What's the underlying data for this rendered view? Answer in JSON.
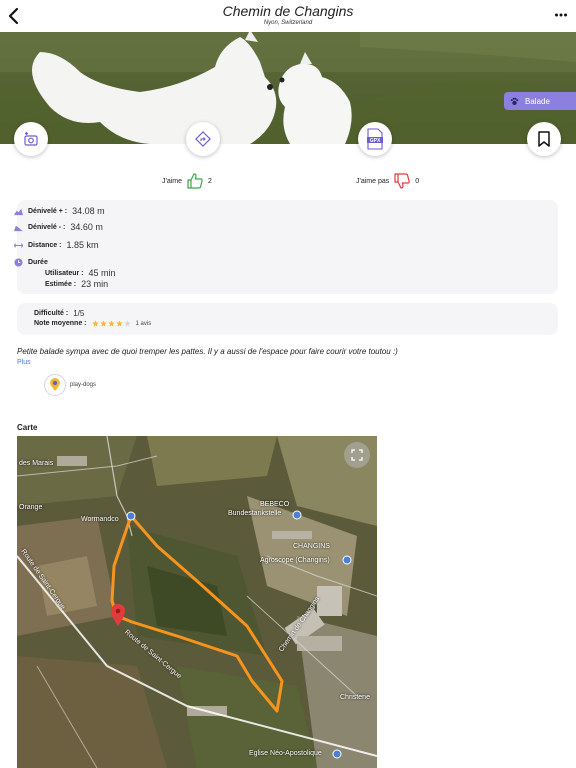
{
  "header": {
    "title": "Chemin de Changins",
    "location": "Nyon, Switzerland"
  },
  "hero": {
    "badge_label": "Balade"
  },
  "votes": {
    "like_label": "J'aime",
    "like_count": "2",
    "dislike_label": "J'aime pas",
    "dislike_count": "0"
  },
  "stats": {
    "elev_gain_label": "Dénivelé + :",
    "elev_gain_value": "34.08 m",
    "elev_loss_label": "Dénivelé - :",
    "elev_loss_value": "34.60 m",
    "distance_label": "Distance :",
    "distance_value": "1.85 km",
    "duration_label": "Durée",
    "user_label": "Utilisateur :",
    "user_value": "45 min",
    "estimated_label": "Estimée :",
    "estimated_value": "23 min"
  },
  "rating": {
    "difficulty_label": "Difficulté :",
    "difficulty_value": "1/5",
    "average_label": "Note moyenne :",
    "stars_value": 4,
    "stars_max": 5,
    "reviews": "1 avis"
  },
  "description": {
    "text": "Petite balade sympa avec de quoi tremper les pattes. Il y a aussi de l'espace pour faire courir votre toutou :)",
    "more_label": "Plus"
  },
  "tags": [
    {
      "label": "play-dogs",
      "icon": "dog-pin-icon"
    }
  ],
  "map": {
    "section_label": "Carte",
    "labels": {
      "marais": "des Marais",
      "orange": "Orange",
      "wormandco": "Wormandco",
      "bebeco": "BEBECO",
      "bundestankstelle": "Bundestankstelle",
      "changins": "CHANGINS",
      "agroscope": "Agroscope (Changins)",
      "route_st_cergue": "Route de Saint-Cergue",
      "route_st_cergue_2": "Route de Saint-Cergue",
      "chemin_changins": "Chemin de Changins",
      "christene": "Christene",
      "eglise": "Eglise Néo-Apostolique"
    }
  },
  "colors": {
    "accent": "#8c7fe0",
    "like": "#3aa64a",
    "dislike": "#e23b3b",
    "route": "#f7941d",
    "pin": "#e23b3b"
  }
}
